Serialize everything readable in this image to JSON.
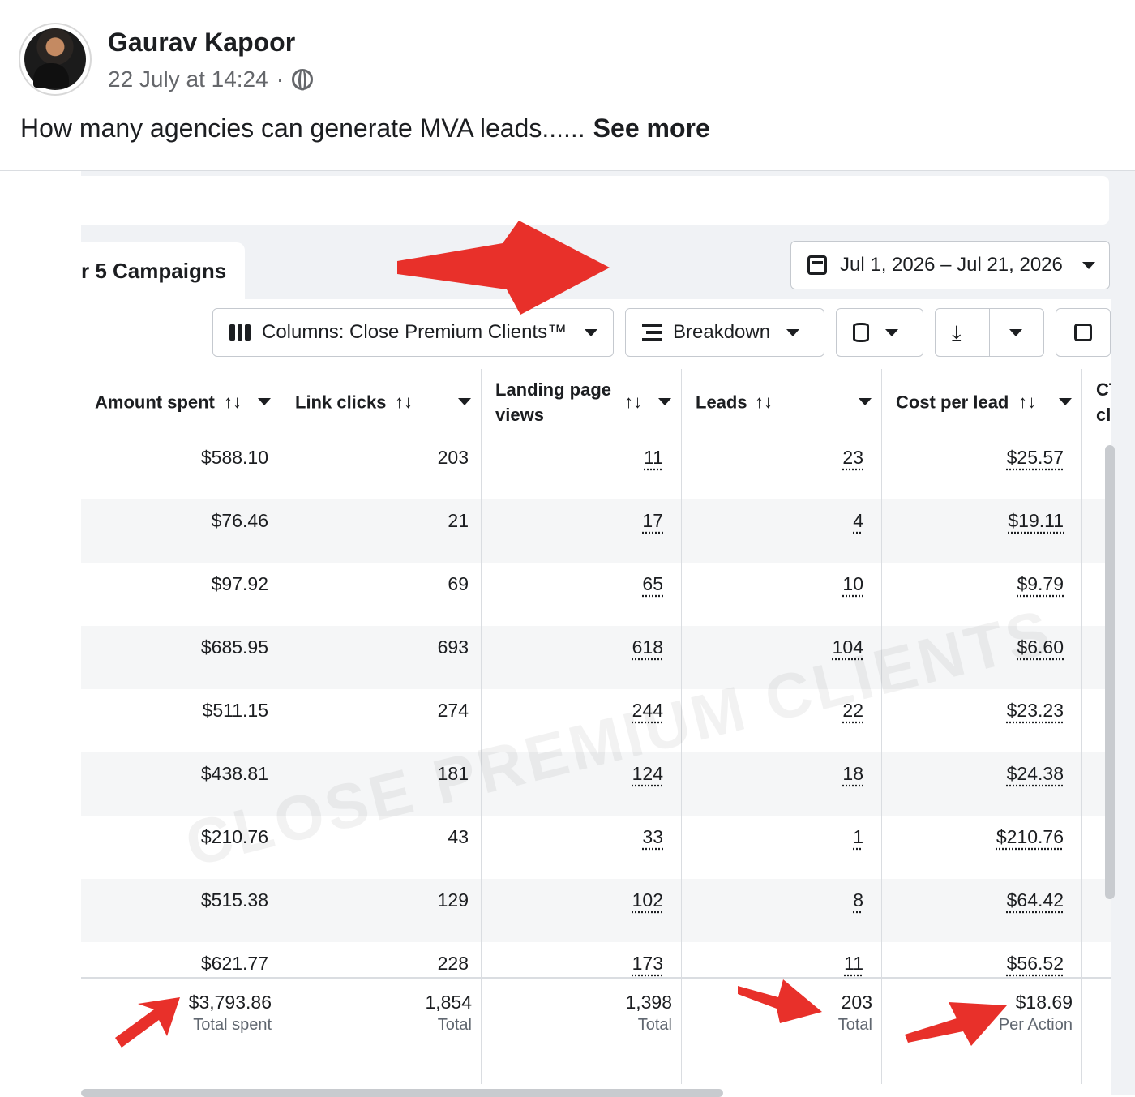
{
  "post": {
    "author": "Gaurav Kapoor",
    "timestamp": "22 July at 14:24",
    "separator": "·",
    "text": "How many agencies can generate MVA leads......",
    "see_more": "See more"
  },
  "ads_manager": {
    "tab_label": "r 5 Campaigns",
    "date_range": "Jul 1, 2026 – Jul 21, 2026",
    "toolbar": {
      "columns_label": "Columns: Close Premium Clients™",
      "breakdown_label": "Breakdown"
    },
    "headers": {
      "amount_spent": "Amount spent",
      "link_clicks": "Link clicks",
      "landing_page_views": "Landing page views",
      "leads": "Leads",
      "cost_per_lead": "Cost per lead",
      "ctr": "CT cli"
    },
    "sort_glyph": "↑↓",
    "rows": [
      {
        "amount": "$588.10",
        "clicks": "203",
        "lpv": "11",
        "leads": "23",
        "cpl": "$25.57"
      },
      {
        "amount": "$76.46",
        "clicks": "21",
        "lpv": "17",
        "leads": "4",
        "cpl": "$19.11"
      },
      {
        "amount": "$97.92",
        "clicks": "69",
        "lpv": "65",
        "leads": "10",
        "cpl": "$9.79"
      },
      {
        "amount": "$685.95",
        "clicks": "693",
        "lpv": "618",
        "leads": "104",
        "cpl": "$6.60"
      },
      {
        "amount": "$511.15",
        "clicks": "274",
        "lpv": "244",
        "leads": "22",
        "cpl": "$23.23"
      },
      {
        "amount": "$438.81",
        "clicks": "181",
        "lpv": "124",
        "leads": "18",
        "cpl": "$24.38"
      },
      {
        "amount": "$210.76",
        "clicks": "43",
        "lpv": "33",
        "leads": "1",
        "cpl": "$210.76"
      },
      {
        "amount": "$515.38",
        "clicks": "129",
        "lpv": "102",
        "leads": "8",
        "cpl": "$64.42"
      },
      {
        "amount": "$621.77",
        "clicks": "228",
        "lpv": "173",
        "leads": "11",
        "cpl": "$56.52"
      }
    ],
    "totals": {
      "amount": "$3,793.86",
      "amount_label": "Total spent",
      "clicks": "1,854",
      "clicks_label": "Total",
      "lpv": "1,398",
      "lpv_label": "Total",
      "leads": "203",
      "leads_label": "Total",
      "cpl": "$18.69",
      "cpl_label": "Per Action"
    },
    "watermark": "CLOSE PREMIUM CLIENTS"
  },
  "colors": {
    "arrow": "#e8302a",
    "border": "#dadde1",
    "row_alt": "#f5f6f7"
  }
}
